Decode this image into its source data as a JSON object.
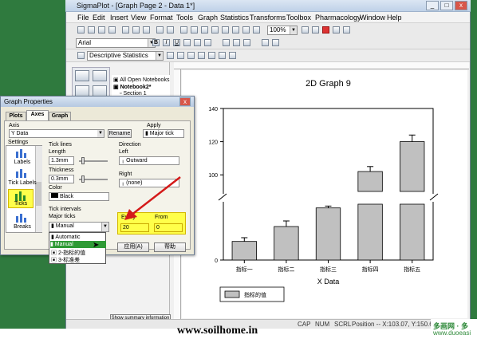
{
  "app": {
    "title": "SigmaPlot - [Graph Page 2 - Data 1*]",
    "menu": [
      "File",
      "Edit",
      "Insert",
      "View",
      "Format",
      "Tools",
      "Graph",
      "Statistics",
      "Transforms",
      "Toolbox",
      "Pharmacology",
      "Window",
      "Help"
    ],
    "font_name": "Arial",
    "zoom": "100%",
    "stats_select": "Descriptive Statistics",
    "notebook_root": "All Open Notebooks",
    "notebook_item": "Notebook2*",
    "notebook_sub": "Section 1",
    "summary_button": "Show summary information",
    "status": [
      "CAP",
      "NUM",
      "SCRL",
      "Position -- X:103.07, Y:150.62"
    ],
    "watermark": "www.soilhome.in",
    "brand_cn": "多画网 · 多",
    "brand_url": "www.duoeasi"
  },
  "dialog": {
    "title": "Graph Properties",
    "tabs": [
      "Plots",
      "Axes",
      "Graph"
    ],
    "axis_label": "Axis",
    "axis_value": "Y Data",
    "rename_button": "Rename",
    "apply_label": "Apply",
    "apply_value": "Major tick",
    "settings_label": "Settings",
    "side_items": [
      "Labels",
      "Tick Labels",
      "Ticks",
      "Breaks"
    ],
    "tick_lines_label": "Tick lines",
    "length_label": "Length",
    "length_value": "1.3mm",
    "thickness_label": "Thickness",
    "thickness_value": "0.3mm",
    "color_label": "Color",
    "color_value": "Black",
    "direction_label": "Direction",
    "left_label": "Left",
    "left_value": "Outward",
    "right_label": "Right",
    "right_value": "(none)",
    "tick_intervals_label": "Tick intervals",
    "major_ticks_label": "Major ticks",
    "major_ticks_value": "Manual",
    "every_label": "Every",
    "every_value": "20",
    "from_label": "From",
    "from_value": "0",
    "dropdown_options": [
      "Automatic",
      "Manual",
      "2-指标的值",
      "3-标准差"
    ],
    "buttons": [
      "应用(A)",
      "帮助"
    ]
  },
  "chart_data": {
    "type": "bar",
    "title": "2D Graph 9",
    "xlabel": "X Data",
    "ylabel": "Y Data",
    "categories": [
      "指标一",
      "指标二",
      "指标三",
      "指标四",
      "指标五"
    ],
    "values": [
      10,
      18,
      28,
      102,
      120
    ],
    "errors": [
      2,
      3,
      1,
      3,
      4
    ],
    "yticks": [
      0,
      100,
      120,
      140
    ],
    "ylim": [
      0,
      140
    ],
    "axis_break": true,
    "legend": "指标的值",
    "bar_color": "#c0c0c0"
  }
}
